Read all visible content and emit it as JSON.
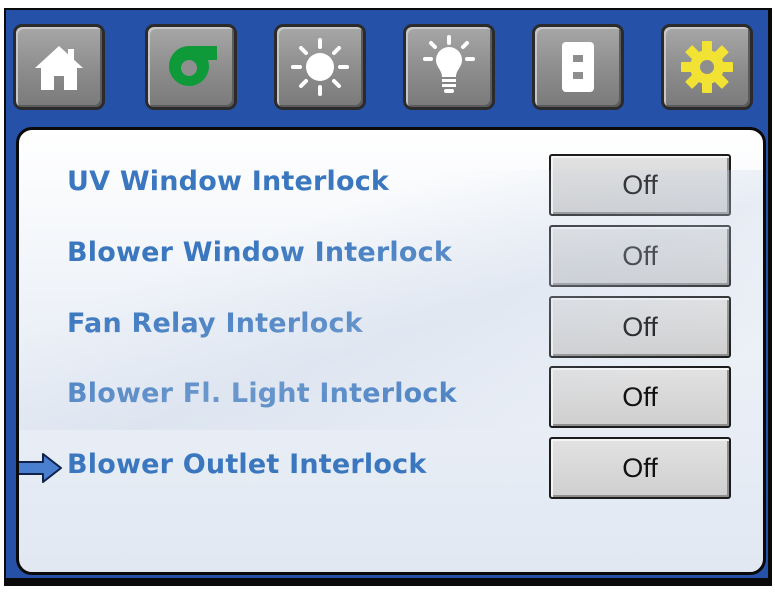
{
  "toolbar": {
    "buttons": [
      {
        "icon": "home-icon"
      },
      {
        "icon": "blower-icon",
        "color": "#0f9a3a"
      },
      {
        "icon": "sun-icon"
      },
      {
        "icon": "light-bulb-icon"
      },
      {
        "icon": "outlet-icon"
      },
      {
        "icon": "gear-icon",
        "color": "#f2e233"
      }
    ]
  },
  "interlocks": [
    {
      "label": "UV Window Interlock",
      "value": "Off"
    },
    {
      "label": "Blower Window Interlock",
      "value": "Off"
    },
    {
      "label": "Fan Relay Interlock",
      "value": "Off"
    },
    {
      "label": "Blower Fl. Light Interlock",
      "value": "Off"
    },
    {
      "label": "Blower Outlet Interlock",
      "value": "Off",
      "selected": true
    }
  ],
  "colors": {
    "background_blue": "#2552a8",
    "label_blue": "#3a77bf",
    "selection_arrow": "#4a7fd0"
  }
}
